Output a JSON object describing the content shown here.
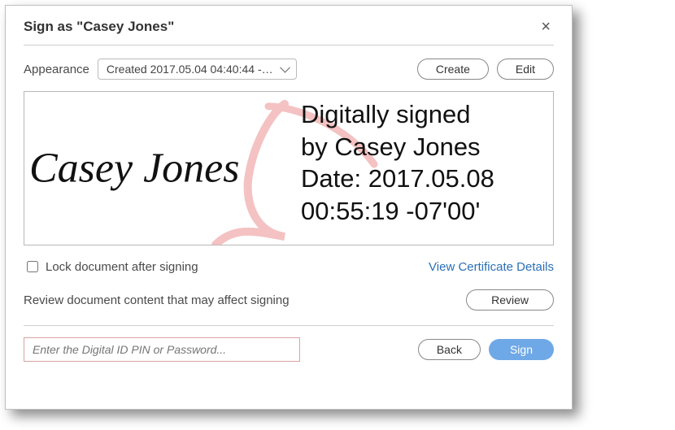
{
  "dialog": {
    "title": "Sign as \"Casey Jones\""
  },
  "appearance": {
    "label": "Appearance",
    "selected": "Created 2017.05.04 04:40:44 -07'...",
    "create_label": "Create",
    "edit_label": "Edit"
  },
  "signature_preview": {
    "name_script": "Casey Jones",
    "detail_line1": "Digitally signed",
    "detail_line2": "by Casey Jones",
    "detail_line3": "Date: 2017.05.08",
    "detail_line4": "00:55:19 -07'00'"
  },
  "lock": {
    "label": "Lock document after signing",
    "checked": false
  },
  "cert_link": "View Certificate Details",
  "review": {
    "label": "Review document content that may affect signing",
    "button": "Review"
  },
  "footer": {
    "pin_placeholder": "Enter the Digital ID PIN or Password...",
    "back_label": "Back",
    "sign_label": "Sign"
  }
}
